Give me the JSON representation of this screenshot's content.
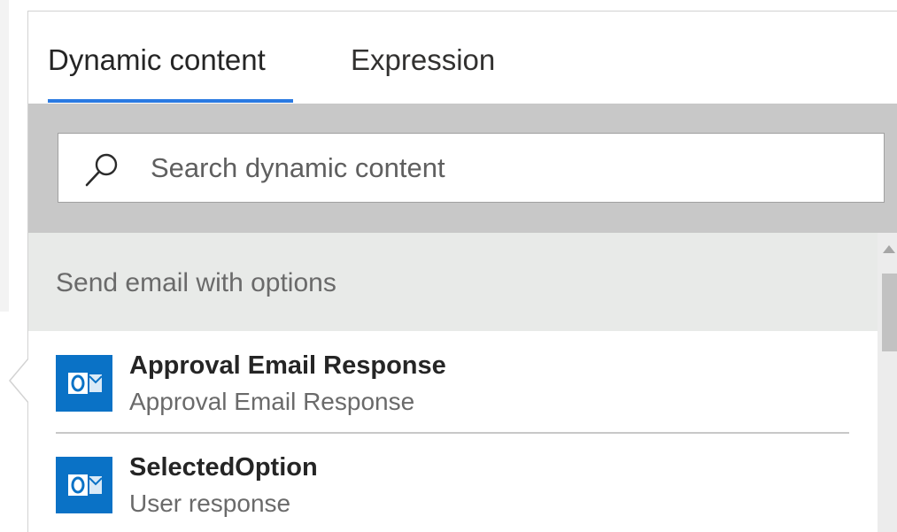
{
  "tabs": [
    {
      "label": "Dynamic content",
      "active": true
    },
    {
      "label": "Expression",
      "active": false
    }
  ],
  "search": {
    "placeholder": "Search dynamic content",
    "value": ""
  },
  "section": {
    "title": "Send email with options",
    "items": [
      {
        "title": "Approval Email Response",
        "subtitle": "Approval Email Response",
        "icon": "outlook-icon"
      },
      {
        "title": "SelectedOption",
        "subtitle": "User response",
        "icon": "outlook-icon"
      }
    ]
  },
  "colors": {
    "accent": "#2a7ae2",
    "outlook_blue": "#0a72c6",
    "search_band": "#c8c8c8",
    "section_header_bg": "#e8eae8"
  }
}
